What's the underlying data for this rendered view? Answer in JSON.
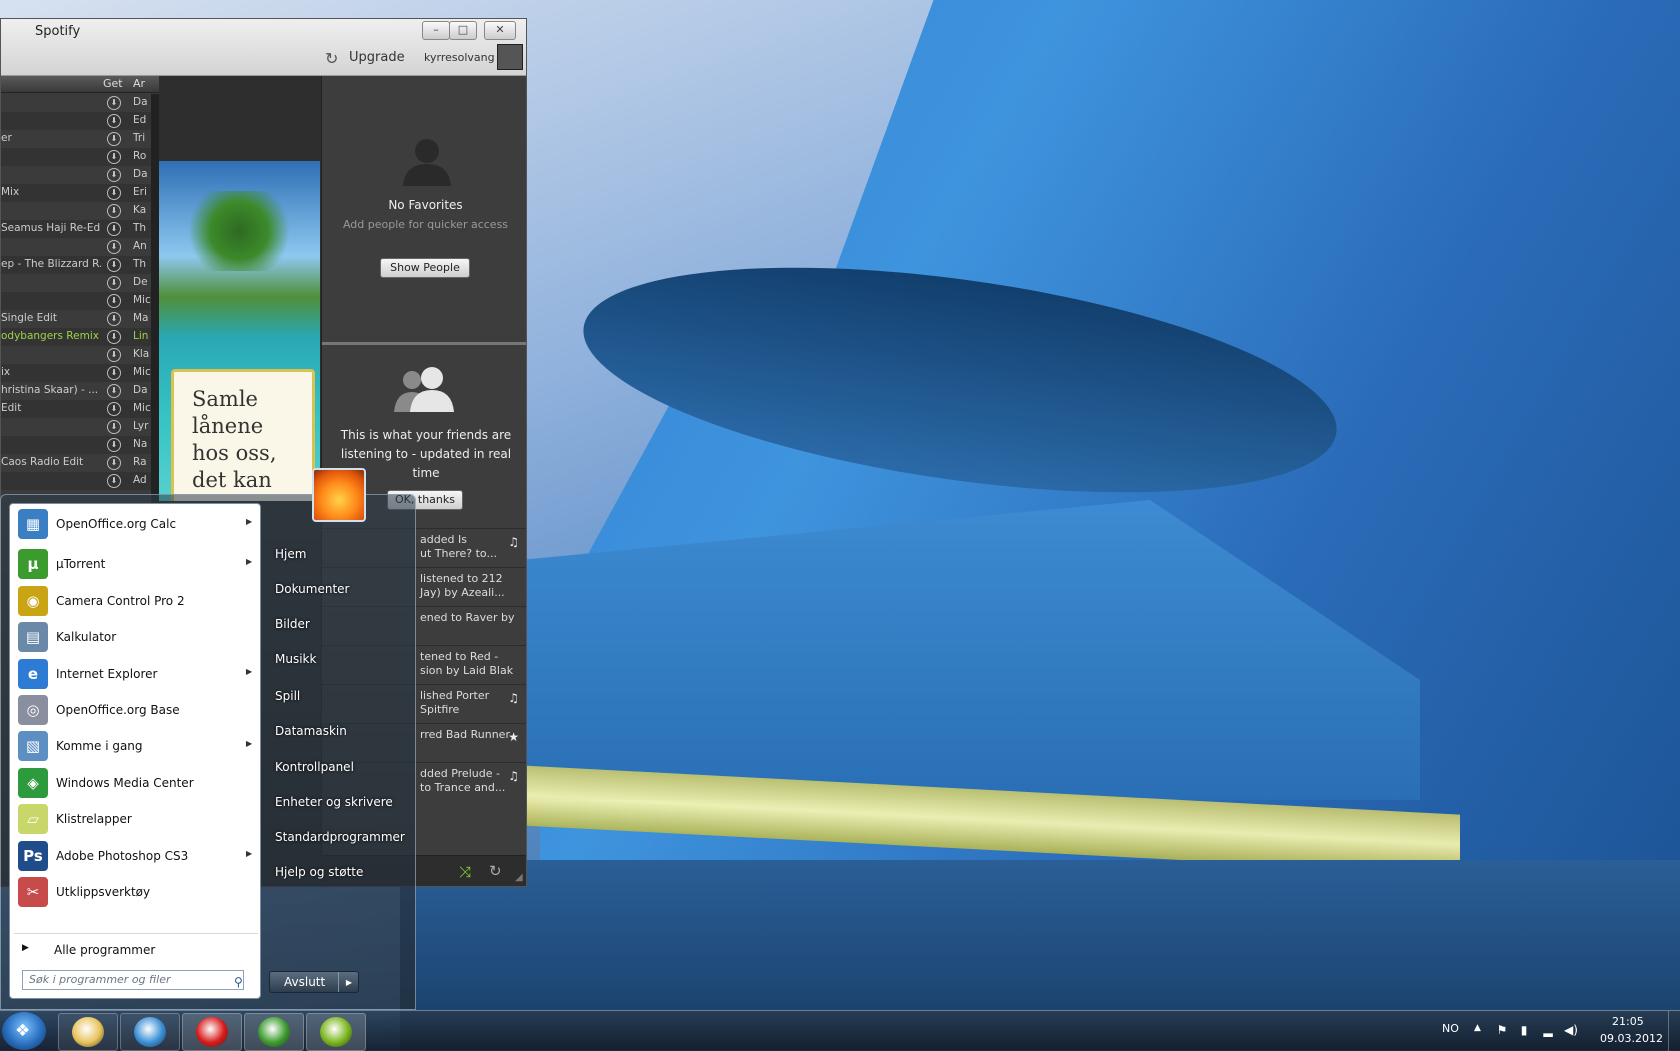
{
  "spotify": {
    "title": "Spotify",
    "upgrade": "Upgrade",
    "username": "kyrresolvang",
    "tracklist": {
      "col_get": "Get",
      "col_artist": "Ar",
      "rows": [
        {
          "name": "",
          "artist": "Da"
        },
        {
          "name": "",
          "artist": "Ed"
        },
        {
          "name": "er",
          "artist": "Tri"
        },
        {
          "name": "",
          "artist": "Ro"
        },
        {
          "name": "",
          "artist": "Da"
        },
        {
          "name": "Mix",
          "artist": "Eri"
        },
        {
          "name": "",
          "artist": "Ka"
        },
        {
          "name": "Seamus Haji Re-Edit",
          "artist": "Th"
        },
        {
          "name": "",
          "artist": "An"
        },
        {
          "name": "ep - The Blizzard R...",
          "artist": "Th"
        },
        {
          "name": "",
          "artist": "De"
        },
        {
          "name": "",
          "artist": "Mic"
        },
        {
          "name": "Single Edit",
          "artist": "Ma"
        },
        {
          "name": "odybangers Remix",
          "artist": "Lin"
        },
        {
          "name": "",
          "artist": "Kla"
        },
        {
          "name": "ix",
          "artist": "Mic"
        },
        {
          "name": "hristina Skaar) - ...",
          "artist": "Da"
        },
        {
          "name": "Edit",
          "artist": "Mic"
        },
        {
          "name": "",
          "artist": "Lyr"
        },
        {
          "name": "",
          "artist": "Na"
        },
        {
          "name": "Caos Radio Edit",
          "artist": "Ra"
        },
        {
          "name": "",
          "artist": "Ad"
        }
      ]
    },
    "ad": {
      "line1": "Samle",
      "line2": "lånene",
      "line3": "hos oss,",
      "line4": "det kan"
    },
    "favorites": {
      "title": "No Favorites",
      "subtitle": "Add people for quicker access",
      "button": "Show People"
    },
    "friends": {
      "text": "This is what your friends are listening to - updated in real time",
      "button": "OK, thanks"
    },
    "feed": [
      {
        "l1": "added Is",
        "l2": "ut There? to...",
        "icon": "♫"
      },
      {
        "l1": "listened to 212",
        "l2": "Jay) by Azeali...",
        "icon": ""
      },
      {
        "l1": "ened to Raver by",
        "l2": "",
        "icon": ""
      },
      {
        "l1": "tened to Red -",
        "l2": "sion by Laid Blak",
        "icon": ""
      },
      {
        "l1": "lished Porter",
        "l2": "Spitfire",
        "icon": "♫"
      },
      {
        "l1": "rred Bad Runner",
        "l2": "",
        "icon": "★"
      },
      {
        "l1": "dded Prelude -",
        "l2": "to Trance and...",
        "icon": "♫"
      }
    ]
  },
  "start_menu": {
    "programs": [
      {
        "label": "OpenOffice.org Calc",
        "icon": "openoffice-calc-icon",
        "arrow": true,
        "color": "#3a7fc4"
      },
      {
        "label": "µTorrent",
        "icon": "utorrent-icon",
        "arrow": true,
        "color": "#3c9b2e"
      },
      {
        "label": "Camera Control Pro 2",
        "icon": "camera-control-icon",
        "arrow": false,
        "color": "#c9a415"
      },
      {
        "label": "Kalkulator",
        "icon": "calculator-icon",
        "arrow": false,
        "color": "#6a88a8"
      },
      {
        "label": "Internet Explorer",
        "icon": "internet-explorer-icon",
        "arrow": true,
        "color": "#2e7bd6"
      },
      {
        "label": "OpenOffice.org Base",
        "icon": "openoffice-base-icon",
        "arrow": false,
        "color": "#8a8fa0"
      },
      {
        "label": "Komme i gang",
        "icon": "getting-started-icon",
        "arrow": true,
        "color": "#5e8fc2"
      },
      {
        "label": "Windows Media Center",
        "icon": "windows-media-center-icon",
        "arrow": false,
        "color": "#2e9a3e"
      },
      {
        "label": "Klistrelapper",
        "icon": "sticky-notes-icon",
        "arrow": false,
        "color": "#c8d66a"
      },
      {
        "label": "Adobe Photoshop CS3",
        "icon": "photoshop-icon",
        "arrow": true,
        "color": "#1f4d8c"
      },
      {
        "label": "Utklippsverktøy",
        "icon": "snipping-tool-icon",
        "arrow": false,
        "color": "#c74b4b"
      }
    ],
    "all_programs": "Alle programmer",
    "search_placeholder": "Søk i programmer og filer",
    "right": [
      {
        "label": "Hjem"
      },
      {
        "label": "Dokumenter"
      },
      {
        "label": "Bilder"
      },
      {
        "label": "Musikk"
      },
      {
        "label": "Spill"
      },
      {
        "label": "Datamaskin"
      },
      {
        "label": "Kontrollpanel"
      },
      {
        "label": "Enheter og skrivere"
      },
      {
        "label": "Standardprogrammer"
      },
      {
        "label": "Hjelp og støtte"
      }
    ],
    "shutdown": "Avslutt"
  },
  "taskbar": {
    "pinned": [
      {
        "name": "explorer",
        "icon": "folder-icon",
        "color": "#e8c35a"
      },
      {
        "name": "chrome",
        "icon": "chrome-icon",
        "color": "#3a8fd6"
      },
      {
        "name": "opera",
        "icon": "opera-icon",
        "color": "#d81a1a"
      },
      {
        "name": "utorrent",
        "icon": "utorrent-icon",
        "color": "#3c9b2e"
      },
      {
        "name": "spotify",
        "icon": "spotify-icon",
        "color": "#7ab51d"
      }
    ],
    "language": "NO",
    "time": "21:05",
    "date": "09.03.2012"
  }
}
